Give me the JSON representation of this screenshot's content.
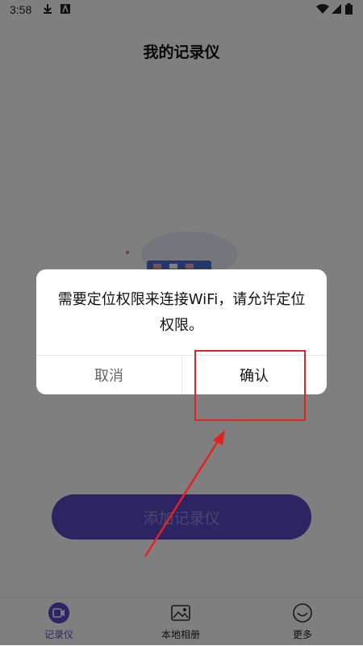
{
  "status_bar": {
    "time": "3:58",
    "icons": [
      "download-icon",
      "app-notification-icon",
      "wifi-icon",
      "signal-icon",
      "battery-icon"
    ]
  },
  "page": {
    "title": "我的记录仪"
  },
  "main": {
    "add_button_label": "添加记录仪"
  },
  "tabbar": {
    "items": [
      {
        "label": "记录仪",
        "icon": "camera-recorder-icon",
        "active": true
      },
      {
        "label": "本地相册",
        "icon": "photo-album-icon",
        "active": false
      },
      {
        "label": "更多",
        "icon": "smiley-icon",
        "active": false
      }
    ]
  },
  "dialog": {
    "message": "需要定位权限来连接WiFi，请允许定位权限。",
    "cancel_label": "取消",
    "confirm_label": "确认"
  },
  "colors": {
    "accent": "#5b4ac7",
    "overlay": "#000000",
    "annotation": "#e52222"
  }
}
